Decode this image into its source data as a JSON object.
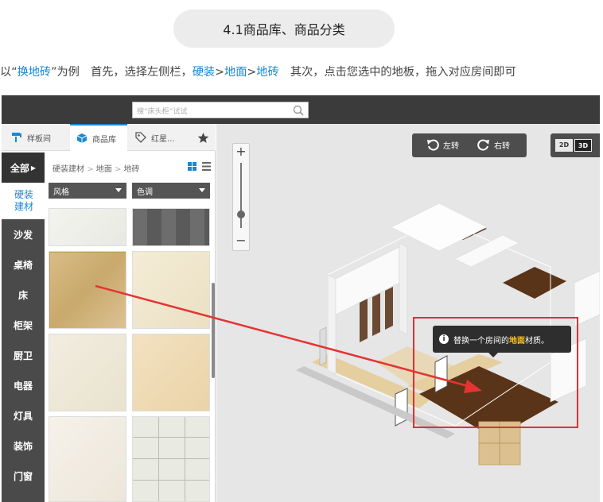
{
  "header": {
    "title": "4.1商品库、商品分类"
  },
  "intro": {
    "p1": "以“",
    "p2": "换地砖",
    "p3": "”为例　首先，选择左侧栏，",
    "p4": "硬装",
    "p5": ">",
    "p6": "地面",
    "p7": ">",
    "p8": "地砖",
    "p9": "　其次，点击您选中的地板，拖入对应房间即可"
  },
  "search": {
    "placeholder": "搜“床头柜”试试"
  },
  "panel": {
    "tabs": [
      {
        "label": "样板间",
        "icon": "paint-roller-icon"
      },
      {
        "label": "商品库",
        "icon": "cube-icon"
      },
      {
        "label": "红星...",
        "icon": "tag-icon"
      }
    ],
    "favorite_icon": "star-icon",
    "categories": [
      {
        "label": "全部"
      },
      {
        "label": "硬装建材"
      },
      {
        "label": "沙发"
      },
      {
        "label": "桌椅"
      },
      {
        "label": "床"
      },
      {
        "label": "柜架"
      },
      {
        "label": "厨卫"
      },
      {
        "label": "电器"
      },
      {
        "label": "灯具"
      },
      {
        "label": "装饰"
      },
      {
        "label": "门窗"
      }
    ],
    "breadcrumb": [
      "硬装建材",
      ">",
      "地面",
      ">",
      "地砖"
    ],
    "filters": [
      {
        "label": "风格"
      },
      {
        "label": "色调"
      }
    ],
    "tiles": [
      {
        "name": "white-marble-tile"
      },
      {
        "name": "dark-grey-wood-tile"
      },
      {
        "name": "beige-marble-tile"
      },
      {
        "name": "cream-tile"
      },
      {
        "name": "white-stone-tile"
      },
      {
        "name": "light-beige-tile"
      },
      {
        "name": "ivory-tile"
      },
      {
        "name": "speckled-grid-tile"
      }
    ]
  },
  "canvas": {
    "rotate_left": "左转",
    "rotate_right": "右转",
    "view_2d": "2D",
    "view_3d": "3D",
    "view_mode": "3D",
    "zoom_in": "+",
    "zoom_out": "−",
    "tooltip": {
      "before": "替换一个房间的",
      "highlight": "地面",
      "after": "材质。"
    }
  },
  "colors": {
    "accent_blue": "#1a88d3",
    "annotation_red": "#e53333",
    "toolbar_dark": "#3b3b3b",
    "tooltip_highlight": "#ffc21a"
  }
}
